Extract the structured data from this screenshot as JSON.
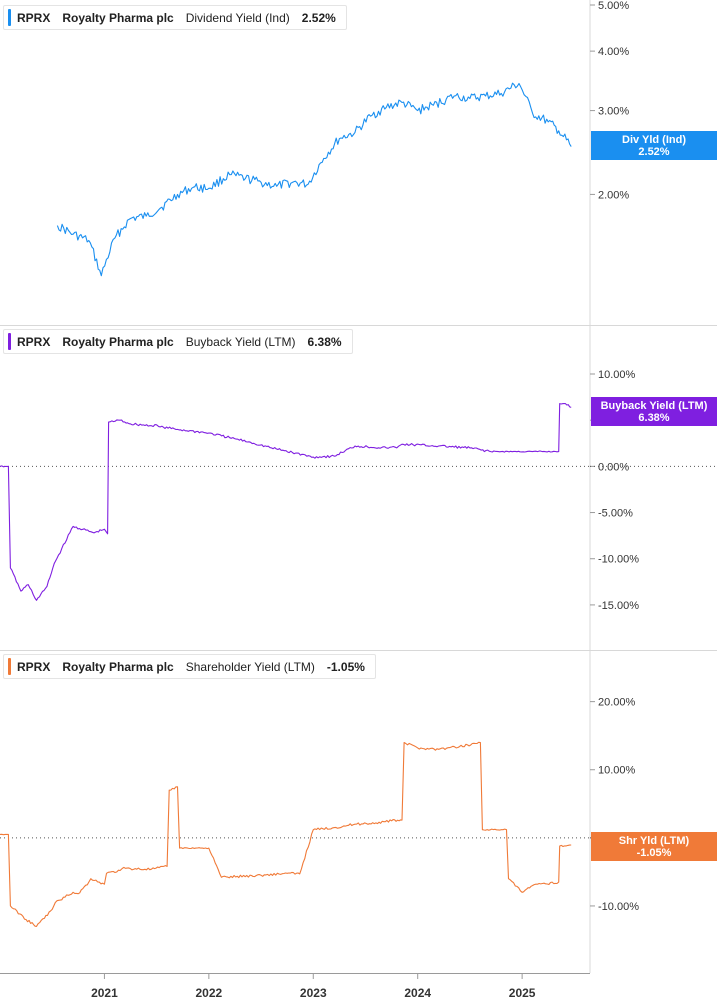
{
  "chart_data": [
    {
      "type": "line",
      "ticker": "RPRX",
      "company": "Royalty Pharma plc",
      "metric": "Dividend Yield (Ind)",
      "value": "2.52%",
      "badge_title": "Div Yld (Ind)",
      "badge_value": "2.52%",
      "color": "#1a8ff0",
      "y_ticks": [
        "5.00%",
        "4.00%",
        "3.00%",
        "2.00%"
      ],
      "y_tick_values": [
        5,
        4,
        3,
        2
      ],
      "ylim": [
        1.2,
        5.0
      ],
      "x": [
        2020.55,
        2020.7,
        2020.85,
        2020.97,
        2021.1,
        2021.25,
        2021.4,
        2021.55,
        2021.7,
        2021.85,
        2022.0,
        2022.2,
        2022.35,
        2022.5,
        2022.65,
        2022.8,
        2022.95,
        2023.1,
        2023.25,
        2023.4,
        2023.55,
        2023.7,
        2023.85,
        2024.0,
        2024.15,
        2024.35,
        2024.5,
        2024.65,
        2024.8,
        2024.97,
        2025.1,
        2025.25,
        2025.35,
        2025.47
      ],
      "y": [
        1.72,
        1.65,
        1.6,
        1.35,
        1.62,
        1.78,
        1.8,
        1.88,
        2.0,
        2.07,
        2.06,
        2.2,
        2.16,
        2.12,
        2.08,
        2.12,
        2.1,
        2.38,
        2.62,
        2.7,
        2.92,
        3.05,
        3.12,
        3.0,
        3.08,
        3.22,
        3.18,
        3.22,
        3.26,
        3.42,
        2.96,
        2.84,
        2.72,
        2.52
      ]
    },
    {
      "type": "line",
      "ticker": "RPRX",
      "company": "Royalty Pharma plc",
      "metric": "Buyback Yield (LTM)",
      "value": "6.38%",
      "badge_title": "Buyback Yield (LTM)",
      "badge_value": "6.38%",
      "color": "#7f1fe0",
      "y_ticks": [
        "10.00%",
        "5.00%",
        "0.00%",
        "-5.00%",
        "-10.00%",
        "-15.00%"
      ],
      "y_tick_values": [
        10,
        5,
        0,
        -5,
        -10,
        -15
      ],
      "ylim": [
        -17.5,
        10.0
      ],
      "x": [
        2020.0,
        2020.05,
        2020.08,
        2020.1,
        2020.2,
        2020.27,
        2020.35,
        2020.45,
        2020.52,
        2020.53,
        2020.7,
        2020.9,
        2021.0,
        2021.03,
        2021.04,
        2021.15,
        2021.25,
        2021.45,
        2021.5,
        2021.52,
        2021.7,
        2022.0,
        2022.2,
        2022.4,
        2022.6,
        2022.8,
        2023.0,
        2023.2,
        2023.4,
        2023.7,
        2023.75,
        2023.8,
        2023.85,
        2024.2,
        2024.5,
        2024.7,
        2024.8,
        2025.1,
        2025.35,
        2025.36,
        2025.4,
        2025.47
      ],
      "y": [
        0,
        0,
        0,
        -11.0,
        -13.5,
        -12.8,
        -14.5,
        -13.0,
        -10.5,
        -10.3,
        -6.5,
        -7.2,
        -6.8,
        -7.3,
        4.8,
        5.0,
        4.6,
        4.4,
        4.5,
        4.3,
        4.0,
        3.6,
        3.1,
        2.6,
        2.0,
        1.5,
        1.0,
        1.1,
        2.2,
        2.0,
        2.1,
        2.0,
        2.4,
        2.2,
        2.0,
        1.6,
        1.6,
        1.6,
        1.6,
        6.8,
        6.8,
        6.38
      ]
    },
    {
      "type": "line",
      "ticker": "RPRX",
      "company": "Royalty Pharma plc",
      "metric": "Shareholder Yield (LTM)",
      "value": "-1.05%",
      "badge_title": "Shr Yld (LTM)",
      "badge_value": "-1.05%",
      "color": "#f07a38",
      "y_ticks": [
        "20.00%",
        "10.00%",
        "-10.00%"
      ],
      "y_tick_values": [
        20,
        10,
        -10
      ],
      "ylim": [
        -15.0,
        22.0
      ],
      "x": [
        2020.0,
        2020.05,
        2020.08,
        2020.1,
        2020.25,
        2020.35,
        2020.5,
        2020.53,
        2020.7,
        2020.75,
        2020.85,
        2020.87,
        2021.0,
        2021.02,
        2021.15,
        2021.17,
        2021.45,
        2021.6,
        2021.62,
        2021.7,
        2021.72,
        2022.0,
        2022.12,
        2022.5,
        2022.75,
        2022.87,
        2023.0,
        2023.2,
        2023.4,
        2023.6,
        2023.75,
        2023.85,
        2023.87,
        2024.0,
        2024.2,
        2024.4,
        2024.6,
        2024.62,
        2024.8,
        2024.85,
        2024.87,
        2025.0,
        2025.1,
        2025.35,
        2025.36,
        2025.47
      ],
      "y": [
        0.5,
        0.5,
        0.5,
        -10.0,
        -12.0,
        -13.0,
        -10.5,
        -9.5,
        -8.0,
        -8.2,
        -6.5,
        -6.0,
        -6.8,
        -5.2,
        -4.8,
        -4.5,
        -4.6,
        -4.2,
        7.0,
        7.5,
        -1.5,
        -1.5,
        -5.8,
        -5.5,
        -5.2,
        -5.3,
        1.2,
        1.5,
        2.0,
        2.2,
        2.5,
        2.6,
        14.0,
        13.2,
        13.0,
        13.4,
        14.0,
        1.2,
        1.2,
        1.2,
        -6.0,
        -8.0,
        -7.0,
        -6.5,
        -1.2,
        -1.05
      ]
    }
  ],
  "x_axis": {
    "ticks": [
      "2021",
      "2022",
      "2023",
      "2024",
      "2025"
    ],
    "tick_values": [
      2021,
      2022,
      2023,
      2024,
      2025
    ]
  }
}
